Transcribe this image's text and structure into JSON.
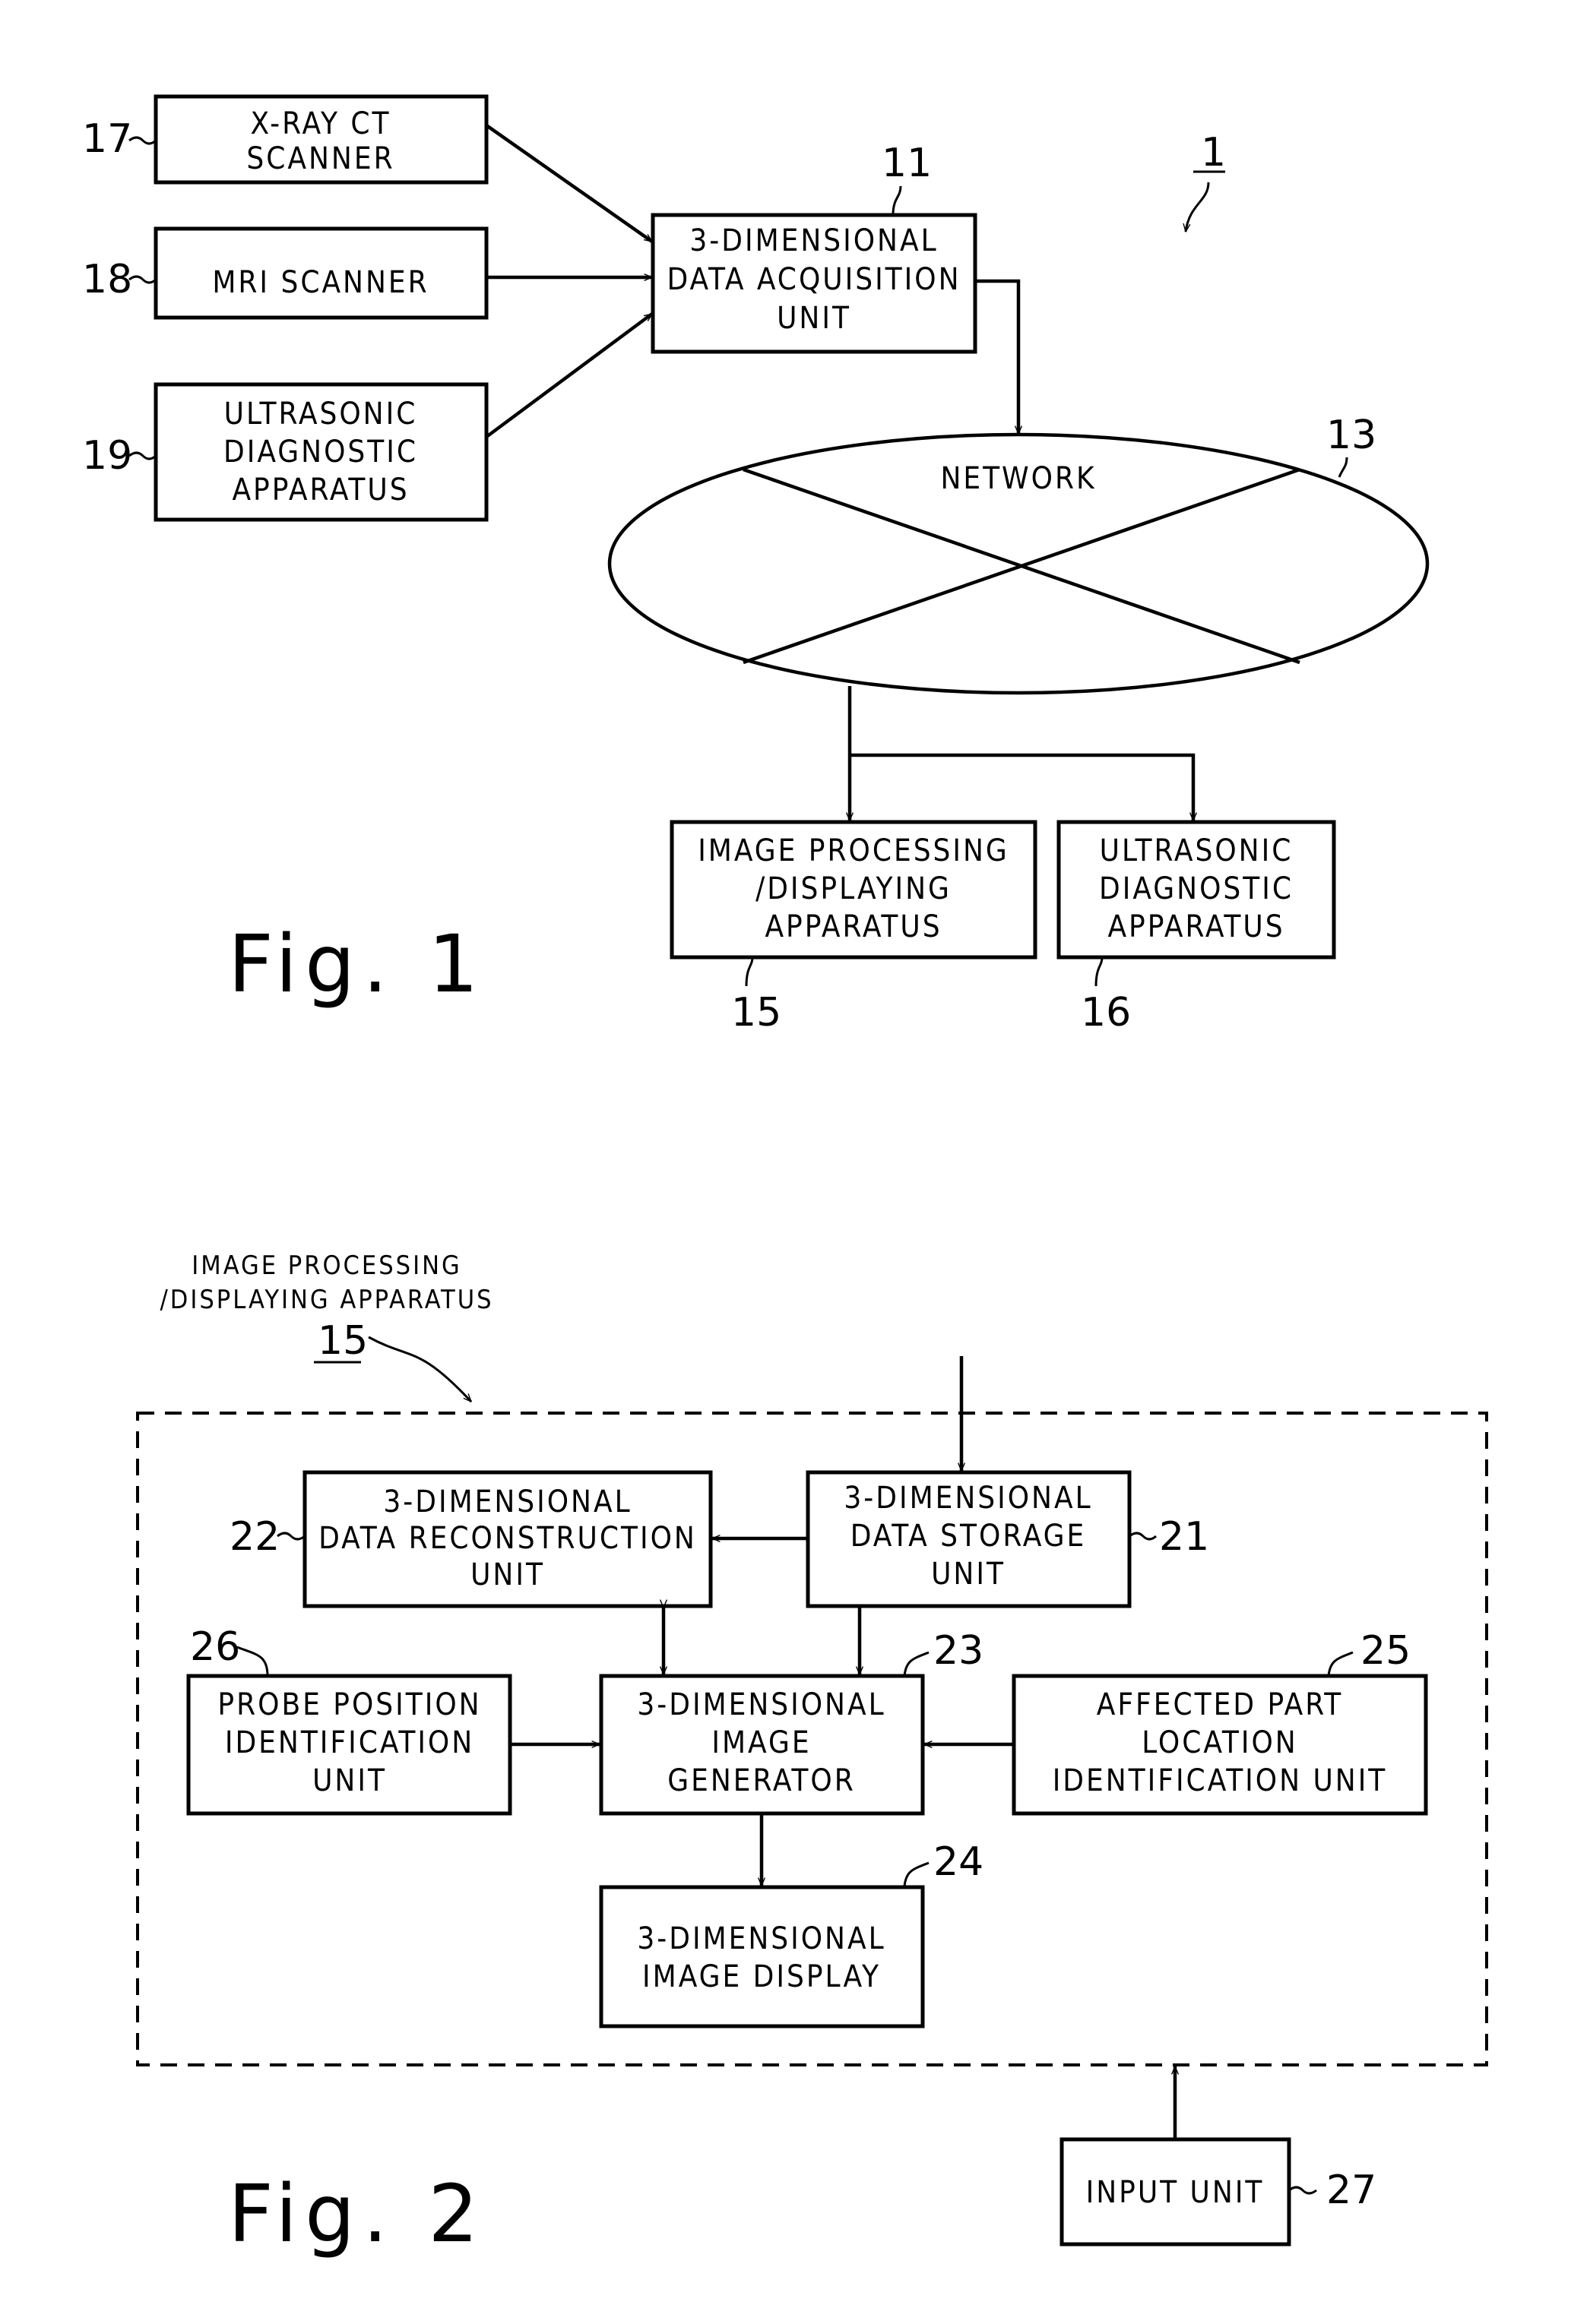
{
  "fig1": {
    "title": "Fig. 1",
    "system_ref": "1",
    "blocks": {
      "xray": {
        "ref": "17",
        "lines": [
          "X-RAY CT",
          "SCANNER"
        ]
      },
      "mri": {
        "ref": "18",
        "lines": [
          "MRI SCANNER"
        ]
      },
      "ultra_src": {
        "ref": "19",
        "lines": [
          "ULTRASONIC",
          "DIAGNOSTIC",
          "APPARATUS"
        ]
      },
      "acq": {
        "ref": "11",
        "lines": [
          "3-DIMENSIONAL",
          "DATA ACQUISITION",
          "UNIT"
        ]
      },
      "network": {
        "ref": "13",
        "label": "NETWORK"
      },
      "imgproc": {
        "ref": "15",
        "lines": [
          "IMAGE PROCESSING",
          "/DISPLAYING",
          "APPARATUS"
        ]
      },
      "ultra_dst": {
        "ref": "16",
        "lines": [
          "ULTRASONIC",
          "DIAGNOSTIC",
          "APPARATUS"
        ]
      }
    }
  },
  "fig2": {
    "title": "Fig. 2",
    "container": {
      "ref": "15",
      "lines": [
        "IMAGE PROCESSING",
        "/DISPLAYING APPARATUS"
      ]
    },
    "blocks": {
      "storage": {
        "ref": "21",
        "lines": [
          "3-DIMENSIONAL",
          "DATA STORAGE",
          "UNIT"
        ]
      },
      "recon": {
        "ref": "22",
        "lines": [
          "3-DIMENSIONAL",
          "DATA RECONSTRUCTION",
          "UNIT"
        ]
      },
      "generator": {
        "ref": "23",
        "lines": [
          "3-DIMENSIONAL",
          "IMAGE",
          "GENERATOR"
        ]
      },
      "display": {
        "ref": "24",
        "lines": [
          "3-DIMENSIONAL",
          "IMAGE DISPLAY"
        ]
      },
      "affected": {
        "ref": "25",
        "lines": [
          "AFFECTED PART",
          "LOCATION",
          "IDENTIFICATION UNIT"
        ]
      },
      "probe": {
        "ref": "26",
        "lines": [
          "PROBE POSITION",
          "IDENTIFICATION",
          "UNIT"
        ]
      },
      "input": {
        "ref": "27",
        "lines": [
          "INPUT UNIT"
        ]
      }
    }
  }
}
